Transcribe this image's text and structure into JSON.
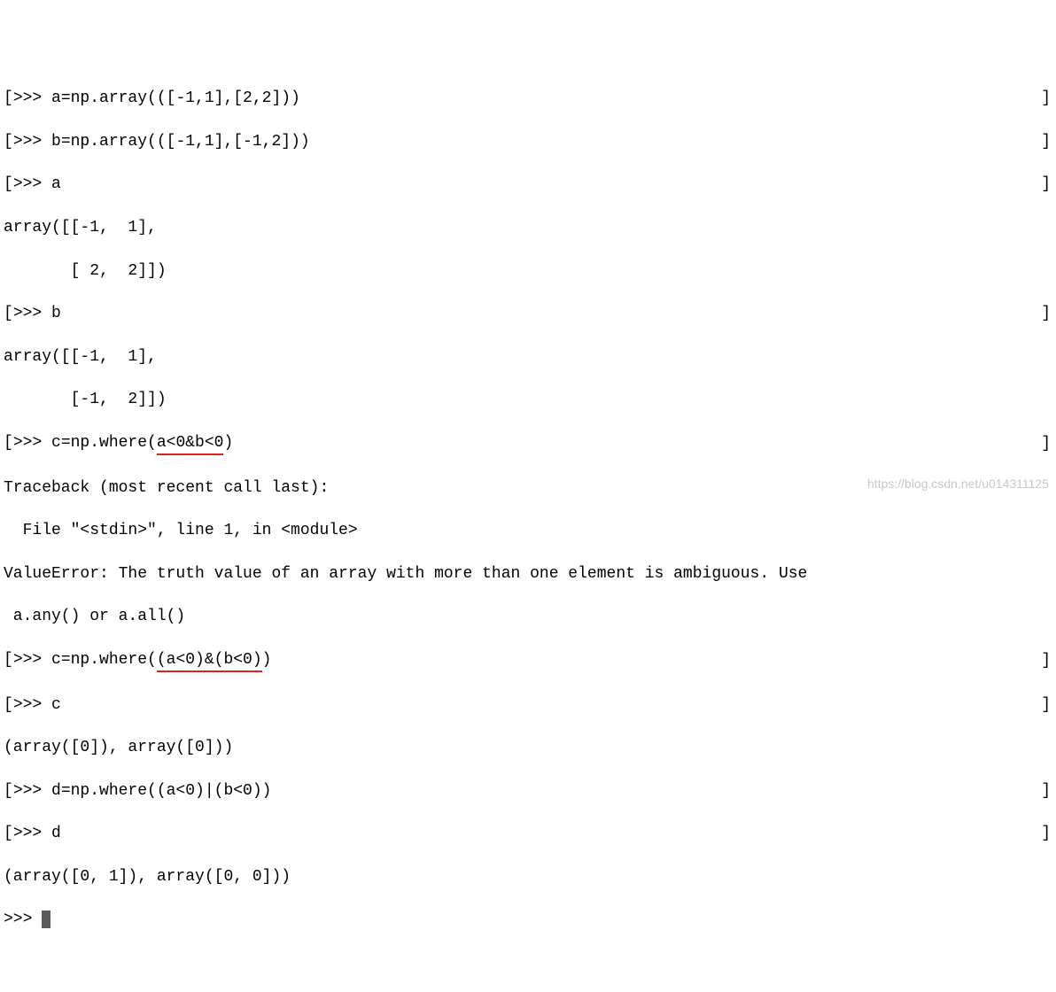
{
  "lines": {
    "l1": ">>> a=np.array(([-1,1],[2,2]))",
    "l2": ">>> b=np.array(([-1,1],[-1,2]))",
    "l3": ">>> a",
    "l4": "array([[-1,  1],",
    "l5": "       [ 2,  2]])",
    "l6": ">>> b",
    "l7": "array([[-1,  1],",
    "l8": "       [-1,  2]])",
    "l9a": ">>> c=np.where(",
    "l9b": "a<0&b<0",
    "l9c": ")",
    "l10": "Traceback (most recent call last):",
    "l11": "  File \"<stdin>\", line 1, in <module>",
    "l12": "ValueError: The truth value of an array with more than one element is ambiguous. Use",
    "l13": " a.any() or a.all()",
    "l14a": ">>> c=np.where(",
    "l14b": "(a<0)&(b<0)",
    "l14c": ")",
    "l15": ">>> c",
    "l16": "(array([0]), array([0]))",
    "l17": ">>> d=np.where((a<0)|(b<0))",
    "l18": ">>> d",
    "l19": "(array([0, 1]), array([0, 0]))",
    "l20": ">>> ",
    "rbracket": "]",
    "lbracket": "["
  },
  "watermark": "https://blog.csdn.net/u014311125"
}
